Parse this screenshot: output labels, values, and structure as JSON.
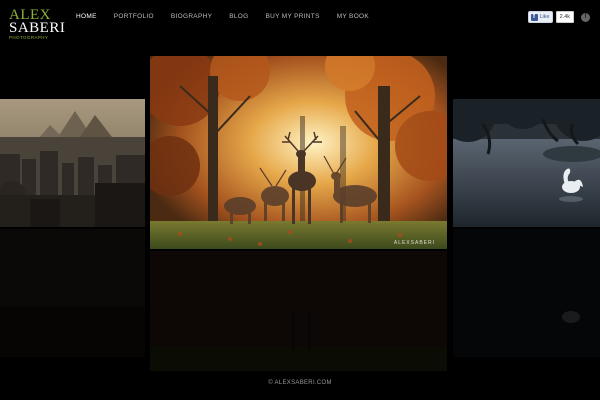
{
  "logo": {
    "line1": "ALEX",
    "line2": "SABERI",
    "line3": "PHOTOGRAPHY"
  },
  "nav": [
    {
      "label": "HOME",
      "active": true
    },
    {
      "label": "PORTFOLIO"
    },
    {
      "label": "BIOGRAPHY"
    },
    {
      "label": "BLOG"
    },
    {
      "label": "BUY MY PRINTS"
    },
    {
      "label": "MY BOOK"
    }
  ],
  "social": {
    "like_label": "Like",
    "like_count": "2.4k"
  },
  "gallery": {
    "watermark": "ALEXSABERI"
  },
  "footer": {
    "copyright": "© ALEXSABERI.COM"
  },
  "colors": {
    "background": "#000000",
    "brand_green": "#8fb03a"
  }
}
